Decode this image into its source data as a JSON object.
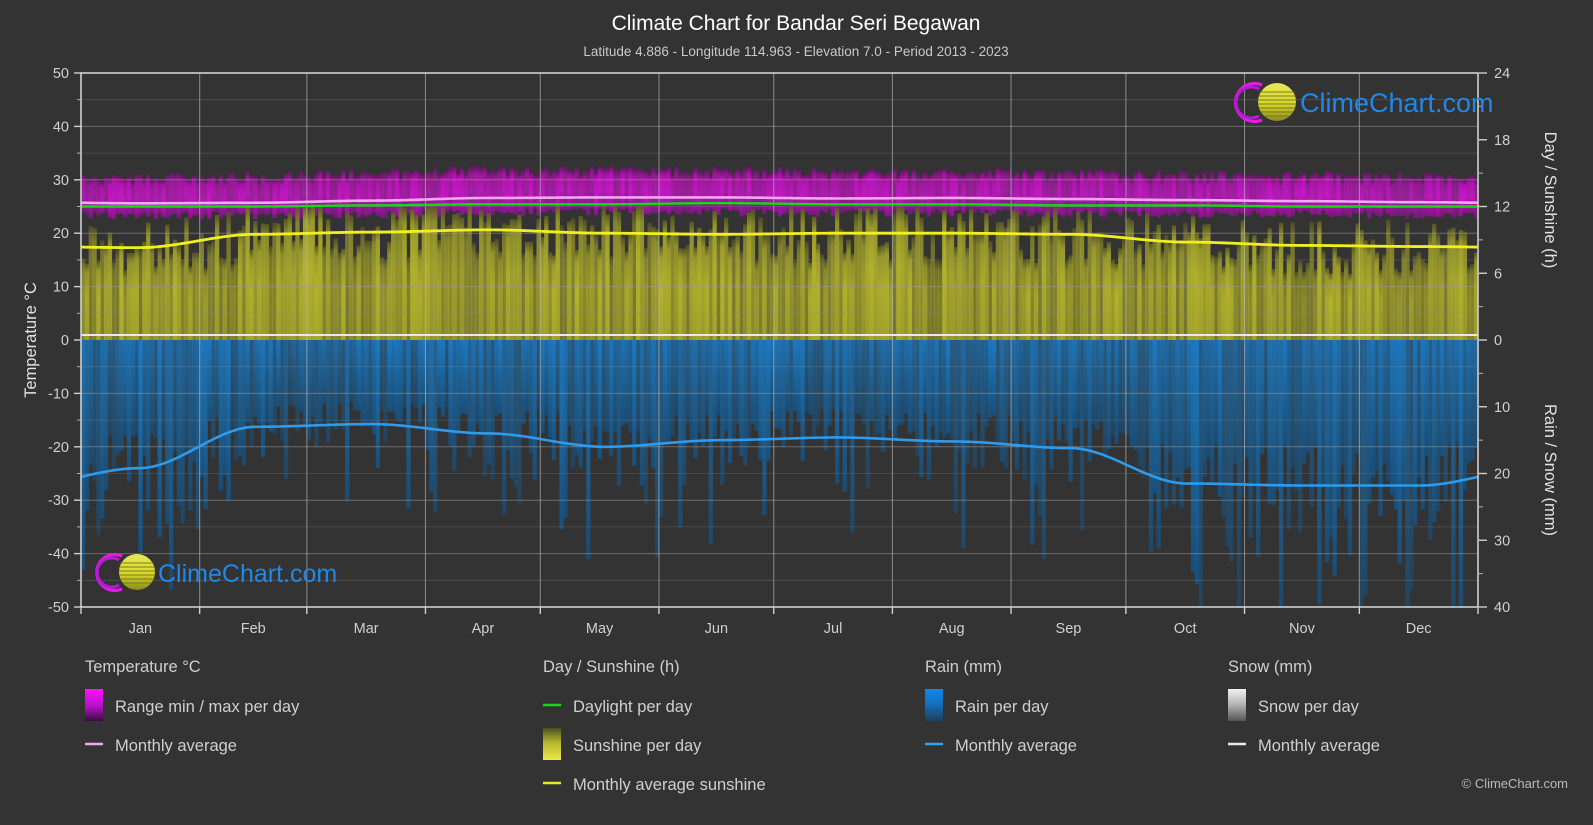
{
  "header": {
    "title": "Climate Chart for Bandar Seri Begawan",
    "subtitle": "Latitude 4.886 - Longitude 114.963 - Elevation 7.0 - Period 2013 - 2023"
  },
  "watermark": {
    "brand": "ClimeChart.com",
    "copyright": "© ClimeChart.com"
  },
  "axes": {
    "left": {
      "title": "Temperature °C",
      "ticks": [
        "50",
        "40",
        "30",
        "20",
        "10",
        "0",
        "-10",
        "-20",
        "-30",
        "-40",
        "-50"
      ]
    },
    "right_top": {
      "title": "Day / Sunshine (h)",
      "ticks": [
        "24",
        "18",
        "12",
        "6",
        "0"
      ]
    },
    "right_bottom": {
      "title": "Rain / Snow (mm)",
      "ticks": [
        "0",
        "10",
        "20",
        "30",
        "40"
      ]
    },
    "bottom": {
      "ticks": [
        "Jan",
        "Feb",
        "Mar",
        "Apr",
        "May",
        "Jun",
        "Jul",
        "Aug",
        "Sep",
        "Oct",
        "Nov",
        "Dec"
      ]
    }
  },
  "legend": {
    "columns": [
      {
        "heading": "Temperature °C",
        "items": [
          {
            "label": "Range min / max per day",
            "marker": "swatch",
            "color": "#ef10ef"
          },
          {
            "label": "Monthly average",
            "marker": "line",
            "color": "#f3a6f3"
          }
        ]
      },
      {
        "heading": "Day / Sunshine (h)",
        "items": [
          {
            "label": "Daylight per day",
            "marker": "line",
            "color": "#16d916"
          },
          {
            "label": "Sunshine per day",
            "marker": "swatch",
            "color": "#e3e33c"
          },
          {
            "label": "Monthly average sunshine",
            "marker": "line",
            "color": "#e8e832"
          }
        ]
      },
      {
        "heading": "Rain (mm)",
        "items": [
          {
            "label": "Rain per day",
            "marker": "swatch",
            "color": "#0b85ee"
          },
          {
            "label": "Monthly average",
            "marker": "line",
            "color": "#36a2ef"
          }
        ]
      },
      {
        "heading": "Snow (mm)",
        "items": [
          {
            "label": "Snow per day",
            "marker": "swatch",
            "color": "#e8e8e8"
          },
          {
            "label": "Monthly average",
            "marker": "line",
            "color": "#e8e8e8"
          }
        ]
      }
    ]
  },
  "colors": {
    "background": "#333333",
    "grid": "#8c8c8c",
    "axis": "#cfcfcf",
    "temp_range": "#c314c3",
    "temp_avg": "#f3a6f3",
    "daylight": "#16d916",
    "sunshine": "#b0b02b",
    "sunshine_avg": "#f0f020",
    "rain": "#1b6ea8",
    "rain_avg": "#2e9bec"
  },
  "chart_data": {
    "type": "area",
    "title": "Climate Chart for Bandar Seri Begawan",
    "subtitle": "Latitude 4.886 - Longitude 114.963 - Elevation 7.0 - Period 2013 - 2023",
    "xlabel": "",
    "ylabel": "Temperature °C",
    "ylim": [
      -50,
      50
    ],
    "y2lim_sunshine": [
      0,
      24
    ],
    "y2lim_rain": [
      0,
      40
    ],
    "grid": true,
    "legend_position": "below",
    "categories": [
      "Jan",
      "Feb",
      "Mar",
      "Apr",
      "May",
      "Jun",
      "Jul",
      "Aug",
      "Sep",
      "Oct",
      "Nov",
      "Dec"
    ],
    "series": [
      {
        "name": "Temperature monthly average (°C)",
        "unit": "°C",
        "values": [
          25.6,
          25.7,
          26.1,
          26.6,
          26.7,
          26.7,
          26.5,
          26.6,
          26.4,
          26.2,
          26.0,
          25.8
        ]
      },
      {
        "name": "Temperature daily max (°C)",
        "unit": "°C",
        "values": [
          30.4,
          30.7,
          31.3,
          31.8,
          31.8,
          31.7,
          31.4,
          31.5,
          31.2,
          31.0,
          30.8,
          30.5
        ]
      },
      {
        "name": "Temperature daily min (°C)",
        "unit": "°C",
        "values": [
          23.3,
          23.3,
          23.6,
          23.9,
          24.0,
          23.9,
          23.7,
          23.8,
          23.7,
          23.6,
          23.6,
          23.4
        ]
      },
      {
        "name": "Daylight per day (h)",
        "unit": "h",
        "values": [
          12.0,
          12.0,
          12.1,
          12.2,
          12.2,
          12.3,
          12.2,
          12.2,
          12.1,
          12.1,
          12.0,
          12.0
        ]
      },
      {
        "name": "Monthly average sunshine (h)",
        "unit": "h",
        "values": [
          8.3,
          9.5,
          9.7,
          9.9,
          9.6,
          9.5,
          9.6,
          9.6,
          9.5,
          8.8,
          8.5,
          8.4
        ]
      },
      {
        "name": "Rain monthly average (mm)",
        "unit": "mm",
        "values": [
          19.2,
          13.0,
          12.6,
          14.0,
          16.0,
          15.0,
          14.6,
          15.2,
          16.2,
          21.5,
          21.8,
          21.8
        ]
      },
      {
        "name": "Snow monthly average (mm)",
        "unit": "mm",
        "values": [
          0,
          0,
          0,
          0,
          0,
          0,
          0,
          0,
          0,
          0,
          0,
          0
        ]
      }
    ]
  }
}
